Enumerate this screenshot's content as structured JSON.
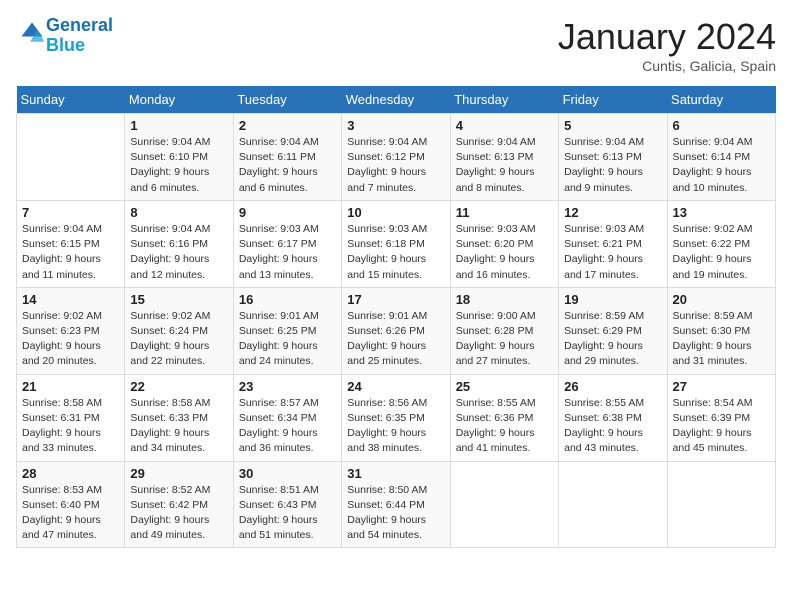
{
  "logo": {
    "line1": "General",
    "line2": "Blue"
  },
  "title": "January 2024",
  "subtitle": "Cuntis, Galicia, Spain",
  "days_header": [
    "Sunday",
    "Monday",
    "Tuesday",
    "Wednesday",
    "Thursday",
    "Friday",
    "Saturday"
  ],
  "weeks": [
    [
      {
        "num": "",
        "info": ""
      },
      {
        "num": "1",
        "info": "Sunrise: 9:04 AM\nSunset: 6:10 PM\nDaylight: 9 hours\nand 6 minutes."
      },
      {
        "num": "2",
        "info": "Sunrise: 9:04 AM\nSunset: 6:11 PM\nDaylight: 9 hours\nand 6 minutes."
      },
      {
        "num": "3",
        "info": "Sunrise: 9:04 AM\nSunset: 6:12 PM\nDaylight: 9 hours\nand 7 minutes."
      },
      {
        "num": "4",
        "info": "Sunrise: 9:04 AM\nSunset: 6:13 PM\nDaylight: 9 hours\nand 8 minutes."
      },
      {
        "num": "5",
        "info": "Sunrise: 9:04 AM\nSunset: 6:13 PM\nDaylight: 9 hours\nand 9 minutes."
      },
      {
        "num": "6",
        "info": "Sunrise: 9:04 AM\nSunset: 6:14 PM\nDaylight: 9 hours\nand 10 minutes."
      }
    ],
    [
      {
        "num": "7",
        "info": "Sunrise: 9:04 AM\nSunset: 6:15 PM\nDaylight: 9 hours\nand 11 minutes."
      },
      {
        "num": "8",
        "info": "Sunrise: 9:04 AM\nSunset: 6:16 PM\nDaylight: 9 hours\nand 12 minutes."
      },
      {
        "num": "9",
        "info": "Sunrise: 9:03 AM\nSunset: 6:17 PM\nDaylight: 9 hours\nand 13 minutes."
      },
      {
        "num": "10",
        "info": "Sunrise: 9:03 AM\nSunset: 6:18 PM\nDaylight: 9 hours\nand 15 minutes."
      },
      {
        "num": "11",
        "info": "Sunrise: 9:03 AM\nSunset: 6:20 PM\nDaylight: 9 hours\nand 16 minutes."
      },
      {
        "num": "12",
        "info": "Sunrise: 9:03 AM\nSunset: 6:21 PM\nDaylight: 9 hours\nand 17 minutes."
      },
      {
        "num": "13",
        "info": "Sunrise: 9:02 AM\nSunset: 6:22 PM\nDaylight: 9 hours\nand 19 minutes."
      }
    ],
    [
      {
        "num": "14",
        "info": "Sunrise: 9:02 AM\nSunset: 6:23 PM\nDaylight: 9 hours\nand 20 minutes."
      },
      {
        "num": "15",
        "info": "Sunrise: 9:02 AM\nSunset: 6:24 PM\nDaylight: 9 hours\nand 22 minutes."
      },
      {
        "num": "16",
        "info": "Sunrise: 9:01 AM\nSunset: 6:25 PM\nDaylight: 9 hours\nand 24 minutes."
      },
      {
        "num": "17",
        "info": "Sunrise: 9:01 AM\nSunset: 6:26 PM\nDaylight: 9 hours\nand 25 minutes."
      },
      {
        "num": "18",
        "info": "Sunrise: 9:00 AM\nSunset: 6:28 PM\nDaylight: 9 hours\nand 27 minutes."
      },
      {
        "num": "19",
        "info": "Sunrise: 8:59 AM\nSunset: 6:29 PM\nDaylight: 9 hours\nand 29 minutes."
      },
      {
        "num": "20",
        "info": "Sunrise: 8:59 AM\nSunset: 6:30 PM\nDaylight: 9 hours\nand 31 minutes."
      }
    ],
    [
      {
        "num": "21",
        "info": "Sunrise: 8:58 AM\nSunset: 6:31 PM\nDaylight: 9 hours\nand 33 minutes."
      },
      {
        "num": "22",
        "info": "Sunrise: 8:58 AM\nSunset: 6:33 PM\nDaylight: 9 hours\nand 34 minutes."
      },
      {
        "num": "23",
        "info": "Sunrise: 8:57 AM\nSunset: 6:34 PM\nDaylight: 9 hours\nand 36 minutes."
      },
      {
        "num": "24",
        "info": "Sunrise: 8:56 AM\nSunset: 6:35 PM\nDaylight: 9 hours\nand 38 minutes."
      },
      {
        "num": "25",
        "info": "Sunrise: 8:55 AM\nSunset: 6:36 PM\nDaylight: 9 hours\nand 41 minutes."
      },
      {
        "num": "26",
        "info": "Sunrise: 8:55 AM\nSunset: 6:38 PM\nDaylight: 9 hours\nand 43 minutes."
      },
      {
        "num": "27",
        "info": "Sunrise: 8:54 AM\nSunset: 6:39 PM\nDaylight: 9 hours\nand 45 minutes."
      }
    ],
    [
      {
        "num": "28",
        "info": "Sunrise: 8:53 AM\nSunset: 6:40 PM\nDaylight: 9 hours\nand 47 minutes."
      },
      {
        "num": "29",
        "info": "Sunrise: 8:52 AM\nSunset: 6:42 PM\nDaylight: 9 hours\nand 49 minutes."
      },
      {
        "num": "30",
        "info": "Sunrise: 8:51 AM\nSunset: 6:43 PM\nDaylight: 9 hours\nand 51 minutes."
      },
      {
        "num": "31",
        "info": "Sunrise: 8:50 AM\nSunset: 6:44 PM\nDaylight: 9 hours\nand 54 minutes."
      },
      {
        "num": "",
        "info": ""
      },
      {
        "num": "",
        "info": ""
      },
      {
        "num": "",
        "info": ""
      }
    ]
  ]
}
